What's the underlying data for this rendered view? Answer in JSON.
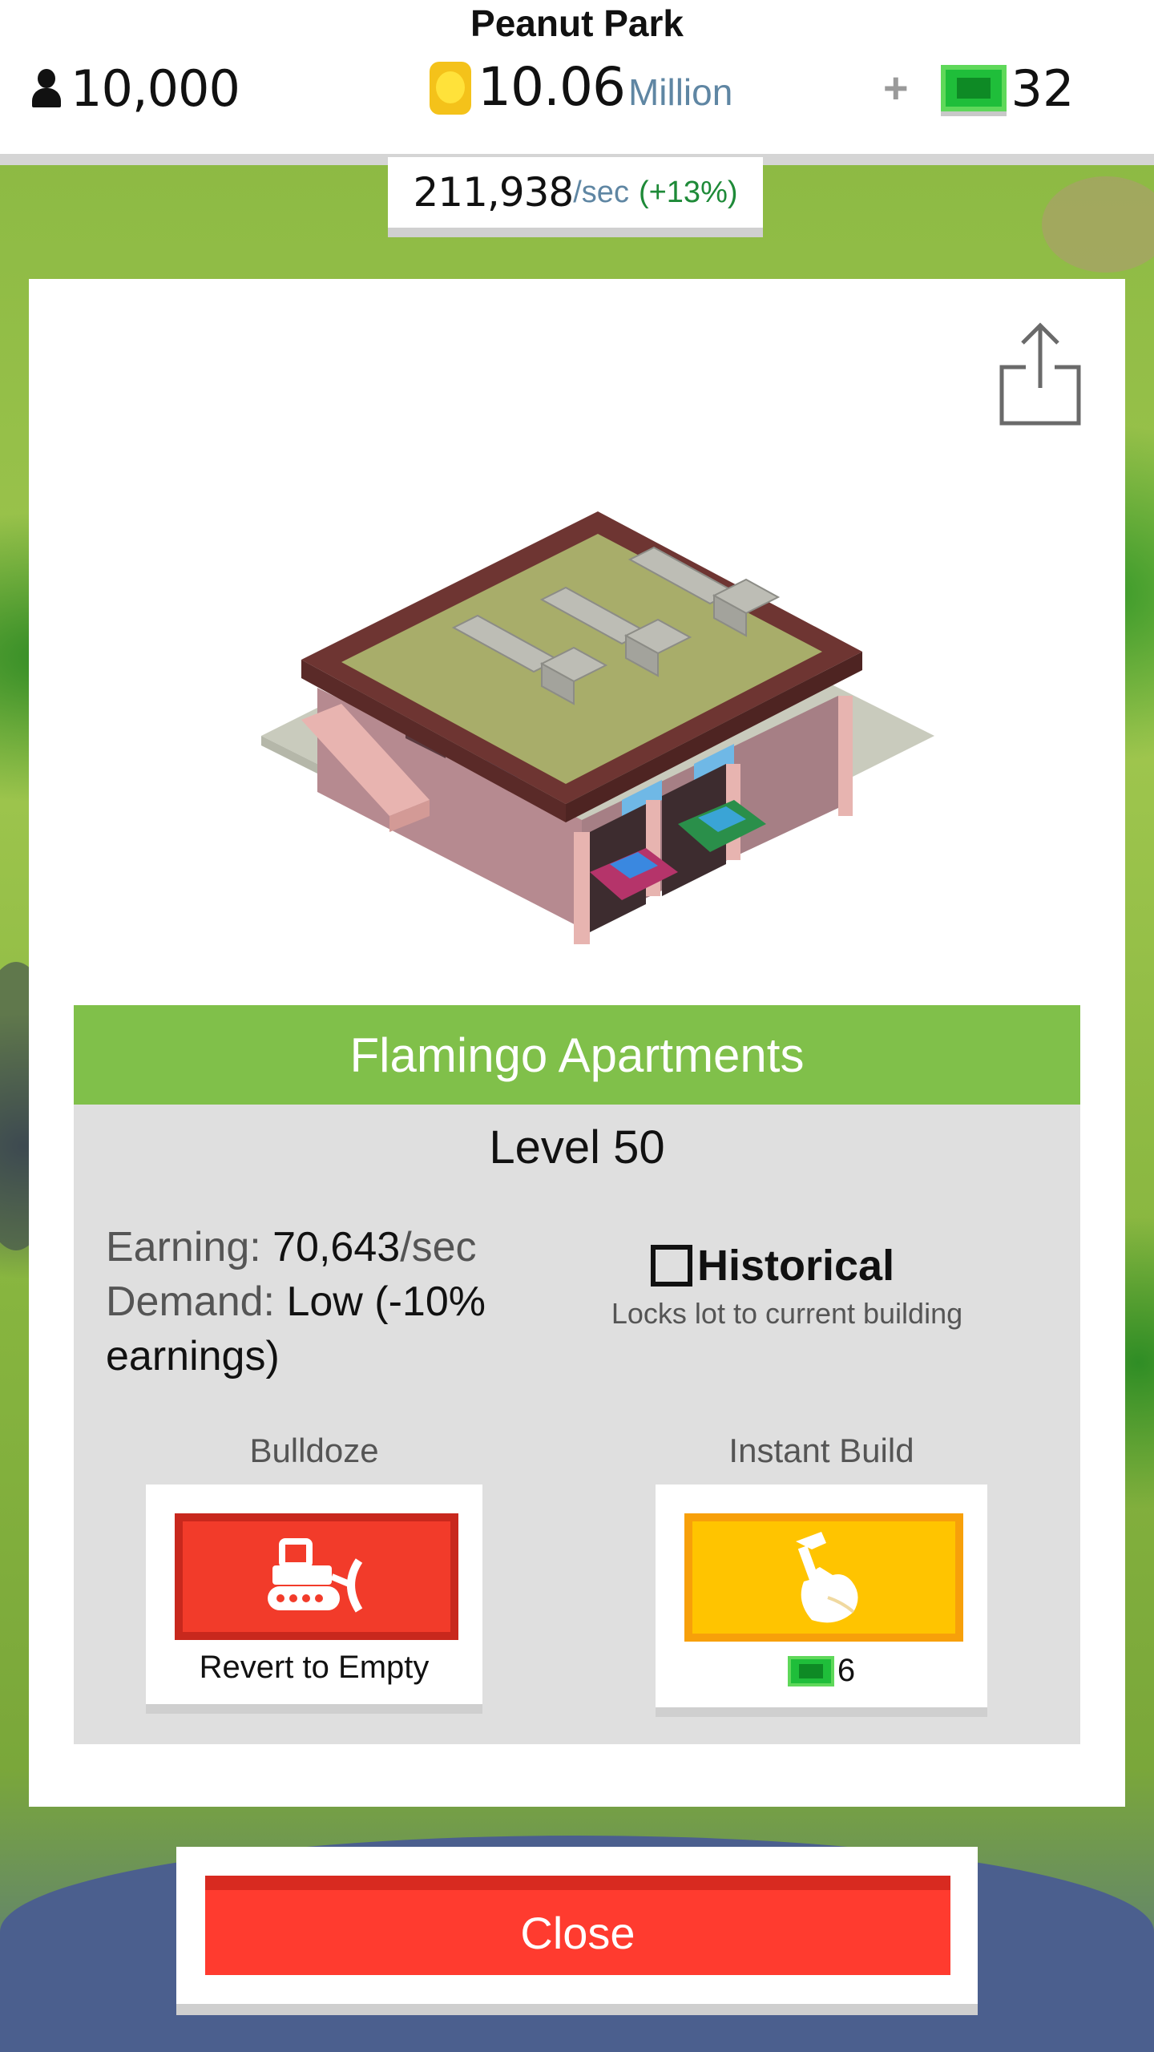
{
  "header": {
    "park_name": "Peanut Park",
    "population": "10,000",
    "money_value": "10.06",
    "money_unit": "Million",
    "plus_label": "+",
    "gems": "32"
  },
  "income": {
    "value": "211,938",
    "unit": "/sec",
    "bonus": "(+13%)"
  },
  "building": {
    "name": "Flamingo Apartments",
    "level": "Level 50",
    "earning_label": "Earning:",
    "earning_value": "70,643",
    "earning_unit": "/sec",
    "demand_label": "Demand:",
    "demand_value": "Low (-10% earnings)",
    "historical_label": "Historical",
    "historical_checked": false,
    "historical_note": "Locks lot to current building"
  },
  "actions": {
    "bulldoze_label": "Bulldoze",
    "bulldoze_caption": "Revert to Empty",
    "instant_label": "Instant Build",
    "instant_cost": "6"
  },
  "close_label": "Close",
  "colors": {
    "title_bar": "#80c04a",
    "bulldoze": "#f23b2a",
    "instant": "#ffc400",
    "close": "#ff3b2f",
    "cash": "#1fbe3a",
    "coin": "#f4c21a"
  },
  "icons": {
    "population": "person-icon",
    "money": "coin-icon",
    "gems": "cash-icon",
    "share": "share-icon",
    "bulldoze": "bulldozer-icon",
    "instant": "hammer-hand-icon"
  }
}
